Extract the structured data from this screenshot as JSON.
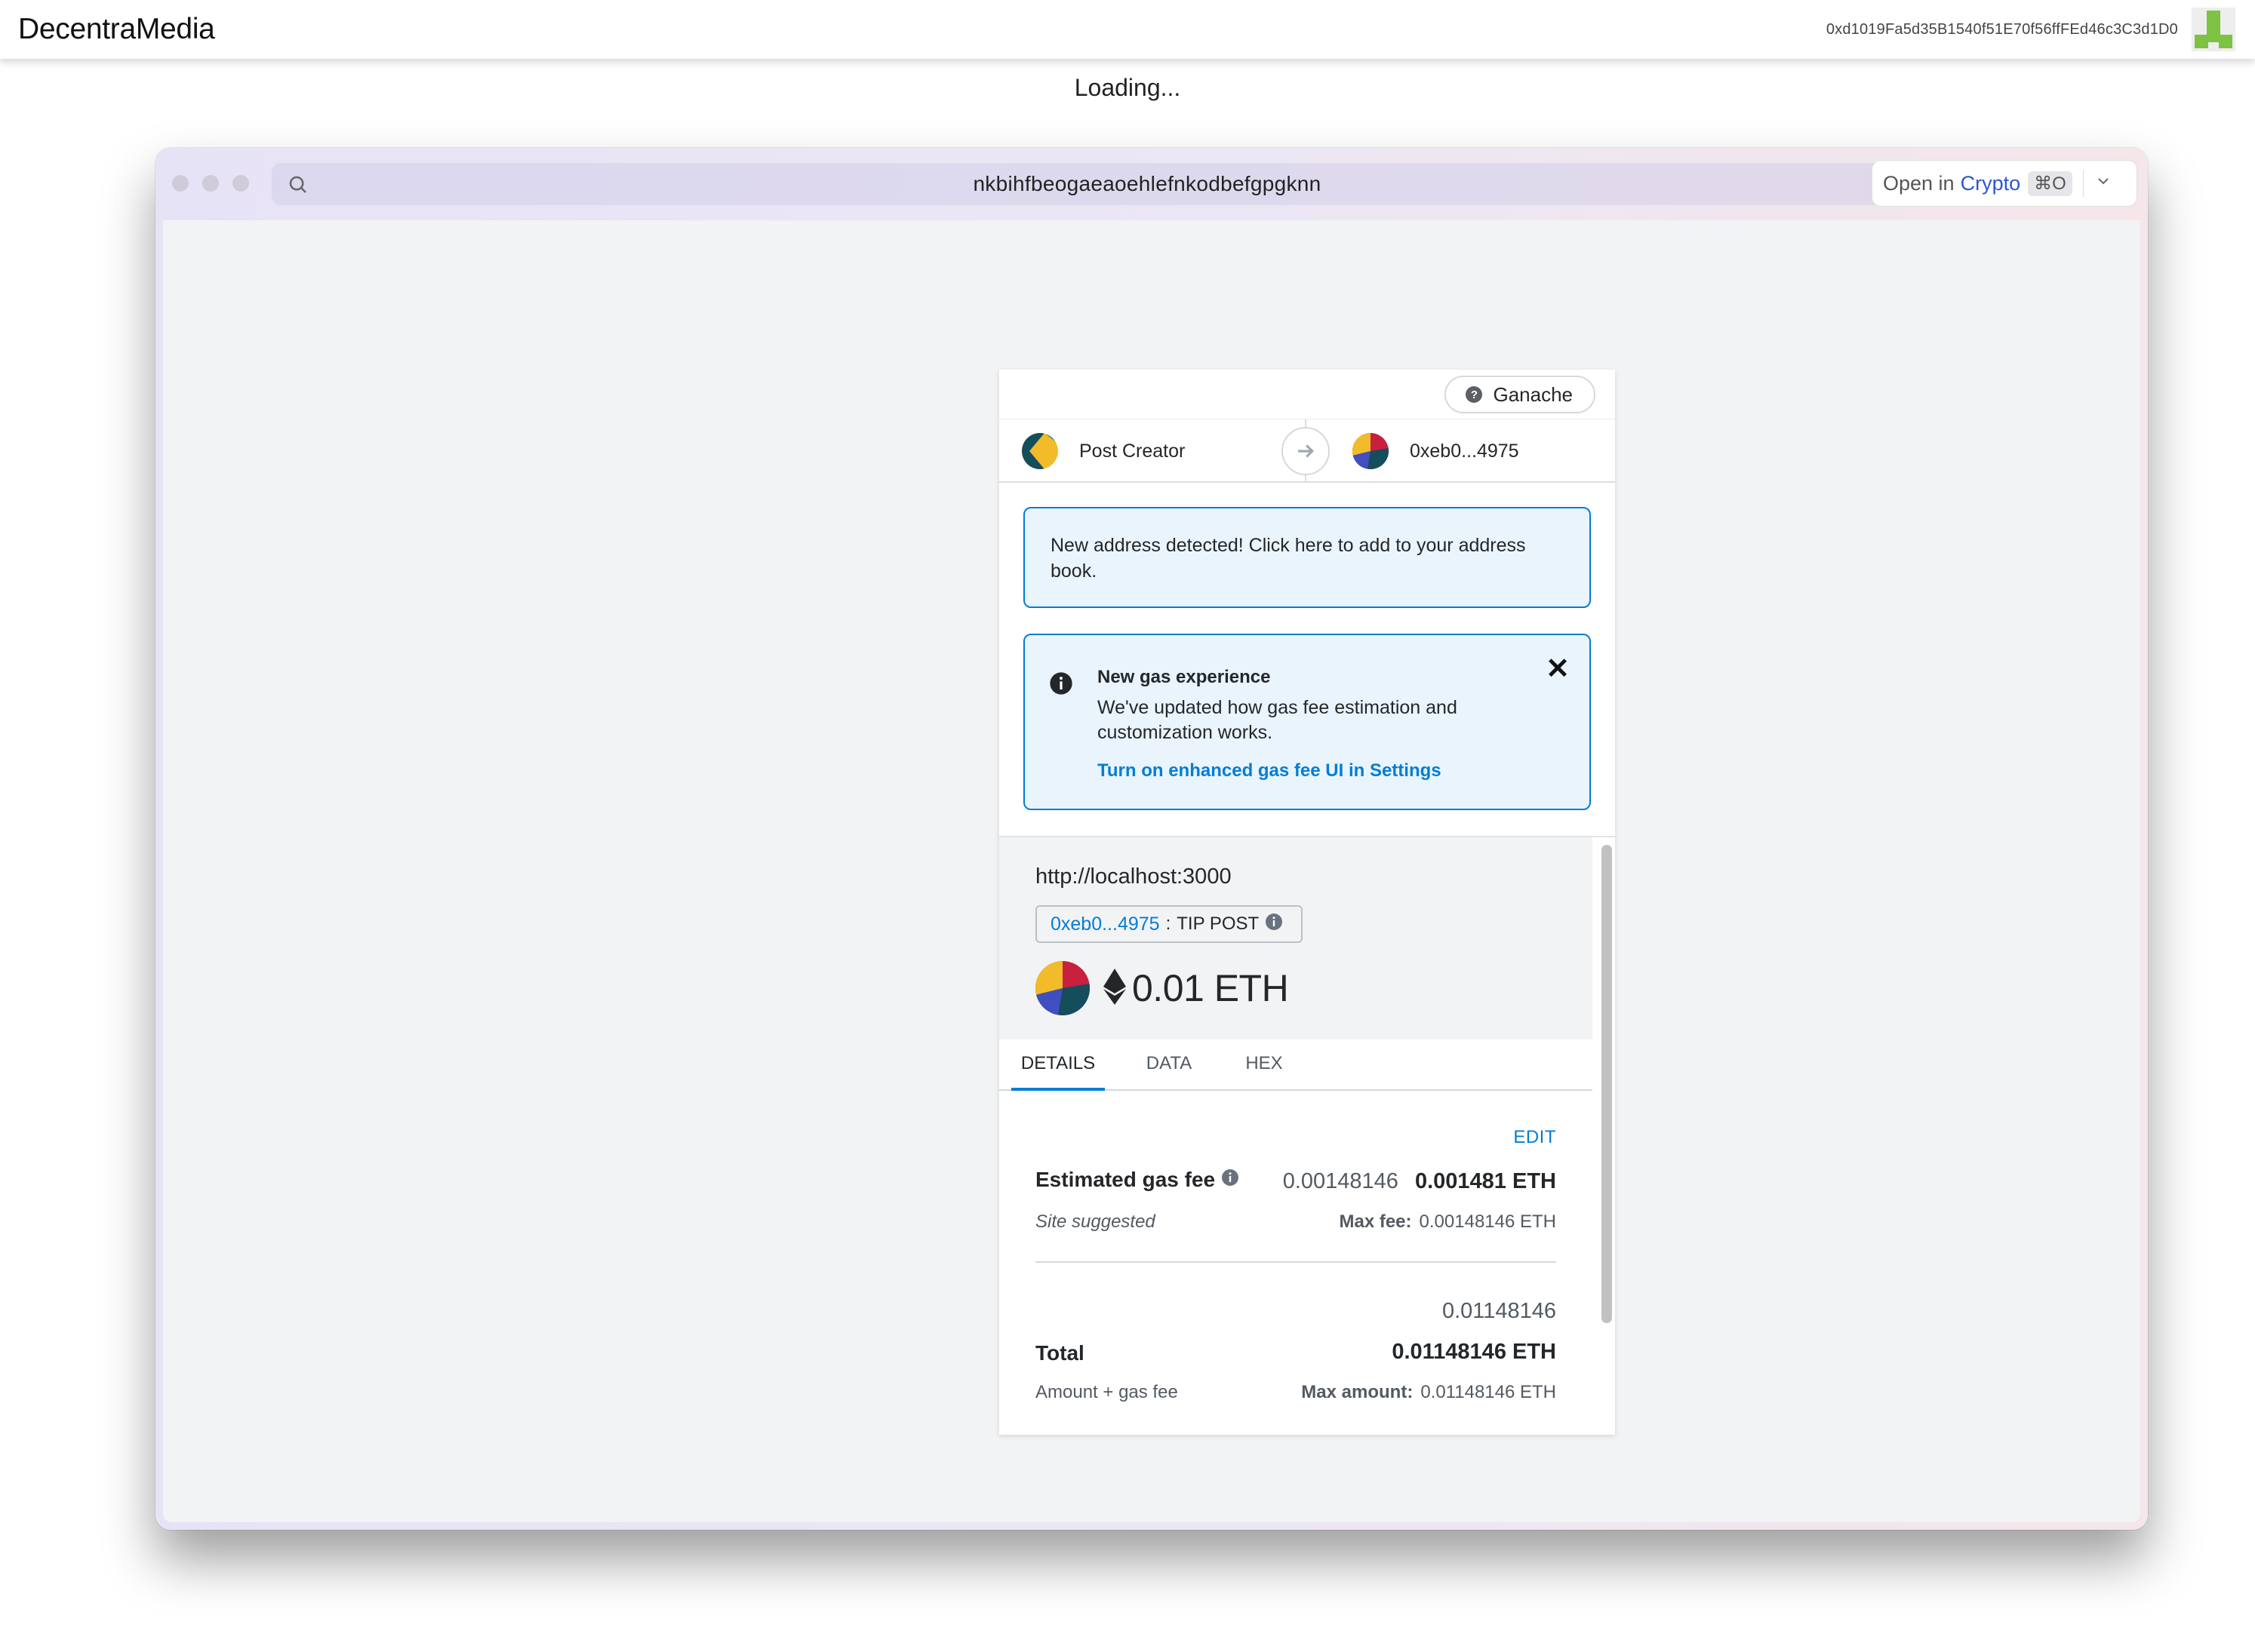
{
  "app": {
    "title": "DecentraMedia",
    "wallet_address": "0xd1019Fa5d35B1540f51E70f56ffFEd46c3C3d1D0",
    "loading": "Loading..."
  },
  "window": {
    "url": "nkbihfbeogaeaoehlefnkodbefgpgknn",
    "open_in_prefix": "Open in",
    "open_in_app": "Crypto",
    "open_in_shortcut": "⌘O"
  },
  "metamask": {
    "network": "Ganache",
    "sender_name": "Post Creator",
    "recipient_name": "0xeb0...4975",
    "address_alert": "New address detected! Click here to add to your address book.",
    "gas_alert": {
      "title": "New gas experience",
      "body": "We've updated how gas fee estimation and customization works.",
      "link": "Turn on enhanced gas fee UI in Settings"
    },
    "origin": "http://localhost:3000",
    "method": {
      "address": "0xeb0...4975",
      "separator": ":",
      "name": "TIP POST"
    },
    "amount": "0.01 ETH",
    "tabs": [
      "DETAILS",
      "DATA",
      "HEX"
    ],
    "details": {
      "edit_label": "EDIT",
      "gas_fee_label": "Estimated gas fee",
      "gas_fee_secondary": "0.00148146",
      "gas_fee_primary": "0.001481 ETH",
      "site_suggested": "Site suggested",
      "max_fee_label": "Max fee:",
      "max_fee_value": "0.00148146 ETH",
      "total_label": "Total",
      "total_secondary": "0.01148146",
      "total_primary": "0.01148146 ETH",
      "amount_gas_label": "Amount + gas fee",
      "max_amount_label": "Max amount:",
      "max_amount_value": "0.01148146 ETH"
    }
  },
  "colors": {
    "accent": "#037dd6",
    "alert_bg": "#eaf4fd",
    "brand_link": "#2e55d4",
    "identicon": "#7dc242"
  }
}
